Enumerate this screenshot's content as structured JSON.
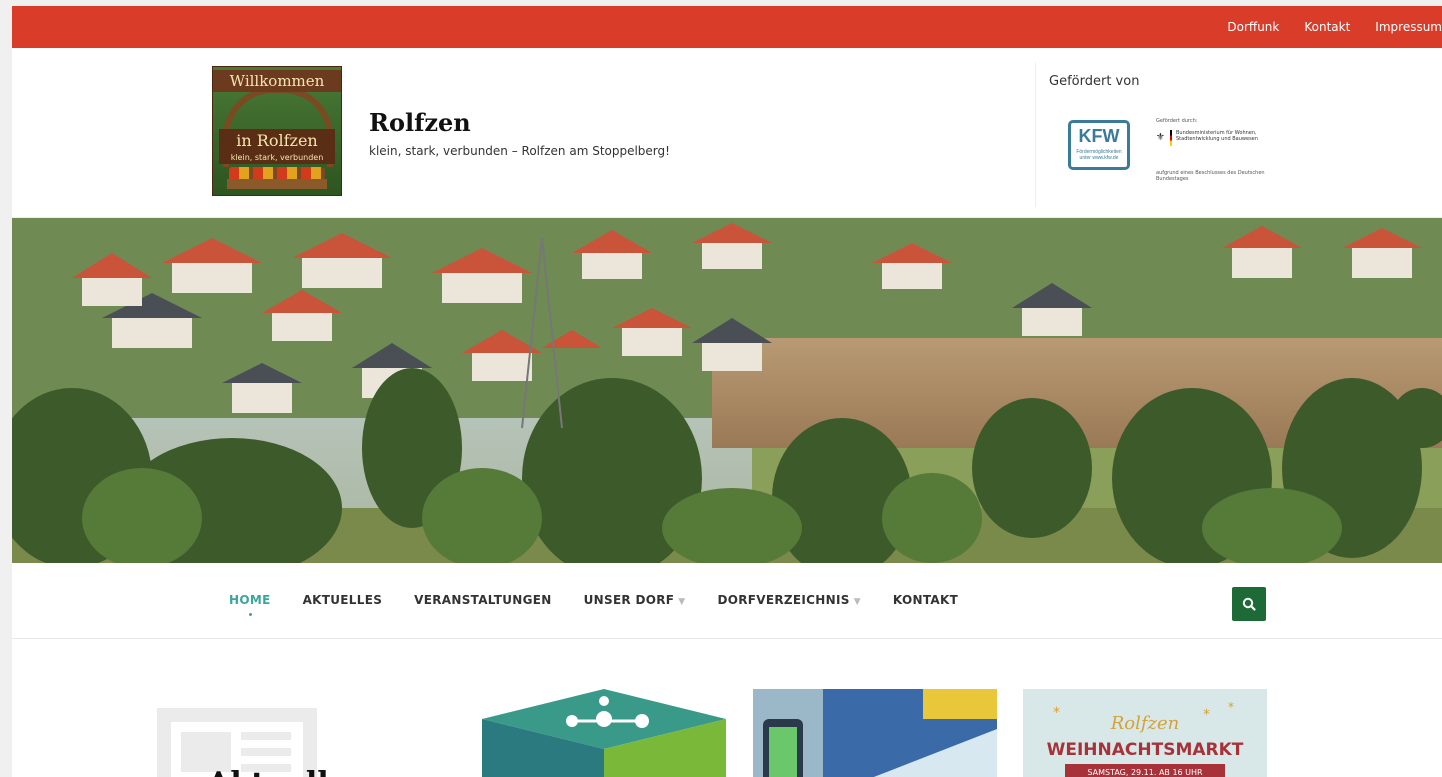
{
  "topbar": {
    "links": [
      "Dorffunk",
      "Kontakt",
      "Impressum"
    ]
  },
  "logo": {
    "line1": "Willkommen",
    "line2": "in Rolfzen",
    "line3": "klein, stark, verbunden"
  },
  "site": {
    "title": "Rolfzen",
    "description": "klein, stark, verbunden – Rolfzen am Stoppelberg!"
  },
  "sponsor": {
    "title": "Gefördert von",
    "kfw_logo": "KFW",
    "kfw_sub": "Förder­möglichkeiten unter www.kfw.de",
    "bund_top": "Gefördert durch:",
    "bund_ministry": "Bundesministerium für Wohnen, Stadtentwicklung und Bauwesen",
    "bund_bottom": "aufgrund eines Beschlusses des Deutschen Bundestages"
  },
  "nav": {
    "items": [
      {
        "label": "HOME",
        "active": true,
        "has_dropdown": false
      },
      {
        "label": "AKTUELLES",
        "active": false,
        "has_dropdown": false
      },
      {
        "label": "VERANSTALTUNGEN",
        "active": false,
        "has_dropdown": false
      },
      {
        "label": "UNSER DORF",
        "active": false,
        "has_dropdown": true
      },
      {
        "label": "DORFVERZEICHNIS",
        "active": false,
        "has_dropdown": true
      },
      {
        "label": "KONTAKT",
        "active": false,
        "has_dropdown": false
      }
    ],
    "search_icon": "search-icon"
  },
  "content": {
    "heading": "Aktuell",
    "thumb3_title": "Rolfzen",
    "thumb3_subtitle": "WEIHNACHTSMARKT",
    "thumb3_date": "SAMSTAG, 29.11. AB 16 UHR"
  },
  "colors": {
    "topbar": "#d93d2a",
    "accent": "#3aa6a0",
    "search_button": "#1d6a36"
  }
}
